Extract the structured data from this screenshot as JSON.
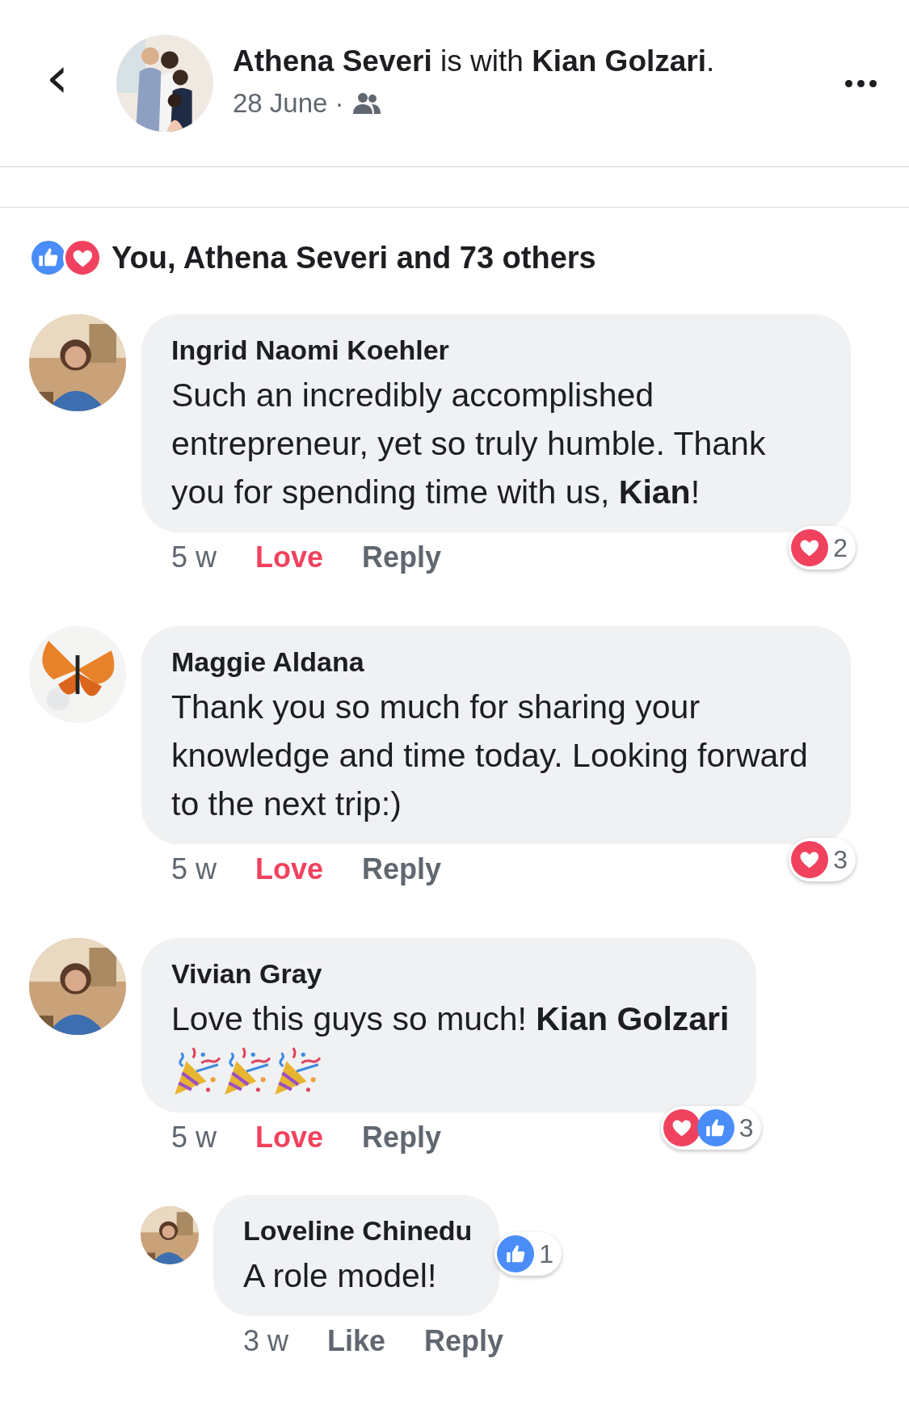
{
  "header": {
    "title": "**Athena Severi** is with **Kian Golzari**.",
    "date": "28 June ·",
    "back": "‹"
  },
  "reactions_summary": {
    "icons": [
      {
        "kind": "like"
      },
      {
        "kind": "love"
      }
    ],
    "text": "You, Athena Severi and 73 others"
  },
  "comments": [
    {
      "name": "Ingrid Naomi Koehler",
      "text": "Such an incredibly accomplished entrepreneur, yet so truly humble. Thank you for spending time with us, **Kian**!",
      "time": "5 w",
      "react_label": "Love",
      "react_active": true,
      "reply_label": "Reply",
      "reactions": [
        {
          "kind": "love"
        }
      ],
      "reaction_count": "2"
    },
    {
      "name": "Maggie Aldana",
      "text": "Thank you so much for sharing your knowledge and time today. Looking forward to the next trip:)",
      "time": "5 w",
      "react_label": "Love",
      "react_active": true,
      "reply_label": "Reply",
      "reactions": [
        {
          "kind": "love"
        }
      ],
      "reaction_count": "3"
    },
    {
      "name": "Vivian Gray",
      "text": "Love this guys so much! **Kian Golzari**",
      "emojis": [
        {
          "kind": "party-popper"
        },
        {
          "kind": "party-popper"
        },
        {
          "kind": "party-popper"
        }
      ],
      "time": "5 w",
      "react_label": "Love",
      "react_active": true,
      "reply_label": "Reply",
      "reactions": [
        {
          "kind": "love"
        },
        {
          "kind": "like"
        }
      ],
      "reaction_count": "3",
      "children": [
        {
          "name": "Loveline Chinedu",
          "text": "A role model!",
          "time": "3 w",
          "react_label": "Like",
          "react_active": false,
          "reply_label": "Reply",
          "reactions": [
            {
              "kind": "like"
            }
          ],
          "reaction_count": "1"
        }
      ]
    }
  ]
}
